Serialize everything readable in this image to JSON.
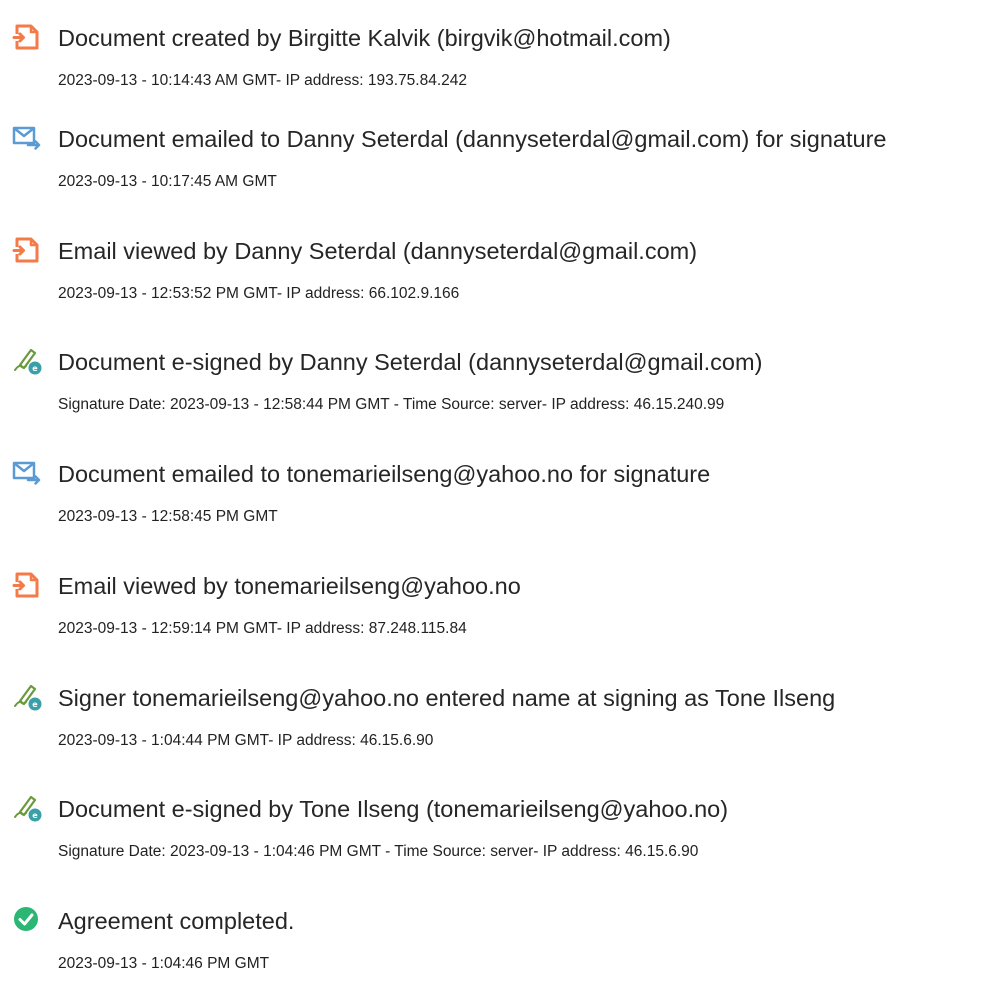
{
  "colors": {
    "document_icon": "#f47a48",
    "email_icon": "#5b9bd5",
    "sign_icon": "#3aa0a8",
    "complete_icon": "#2bb673"
  },
  "events": [
    {
      "icon": "document-icon",
      "title": "Document created by Birgitte Kalvik (birgvik@hotmail.com)",
      "detail": "2023-09-13 - 10:14:43 AM GMT- IP address: 193.75.84.242"
    },
    {
      "icon": "email-sent-icon",
      "title": "Document emailed to Danny Seterdal (dannyseterdal@gmail.com) for signature",
      "detail": "2023-09-13 - 10:17:45 AM GMT"
    },
    {
      "icon": "document-icon",
      "title": "Email viewed by Danny Seterdal (dannyseterdal@gmail.com)",
      "detail": "2023-09-13 - 12:53:52 PM GMT- IP address: 66.102.9.166"
    },
    {
      "icon": "e-sign-icon",
      "title": "Document e-signed by Danny Seterdal (dannyseterdal@gmail.com)",
      "detail": "Signature Date: 2023-09-13 - 12:58:44 PM GMT - Time Source: server- IP address: 46.15.240.99"
    },
    {
      "icon": "email-sent-icon",
      "title": "Document emailed to tonemarieilseng@yahoo.no for signature",
      "detail": "2023-09-13 - 12:58:45 PM GMT"
    },
    {
      "icon": "document-icon",
      "title": "Email viewed by tonemarieilseng@yahoo.no",
      "detail": "2023-09-13 - 12:59:14 PM GMT- IP address: 87.248.115.84"
    },
    {
      "icon": "e-sign-icon",
      "title": "Signer tonemarieilseng@yahoo.no entered name at signing as Tone Ilseng",
      "detail": "2023-09-13 - 1:04:44 PM GMT- IP address: 46.15.6.90"
    },
    {
      "icon": "e-sign-icon",
      "title": "Document e-signed by Tone Ilseng (tonemarieilseng@yahoo.no)",
      "detail": "Signature Date: 2023-09-13 - 1:04:46 PM GMT - Time Source: server- IP address: 46.15.6.90"
    },
    {
      "icon": "check-circle-icon",
      "title": "Agreement completed.",
      "detail": "2023-09-13 - 1:04:46 PM GMT"
    }
  ]
}
